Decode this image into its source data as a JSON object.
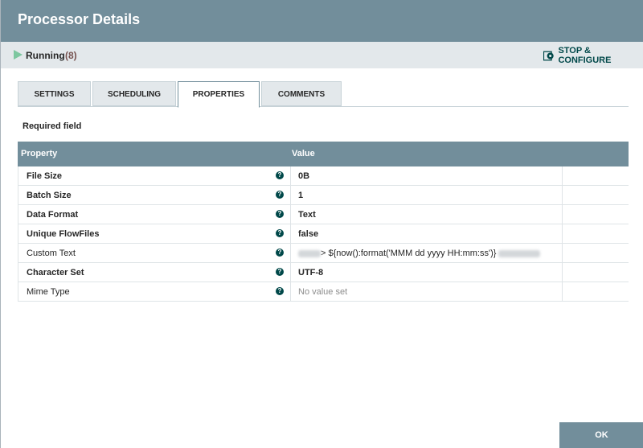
{
  "dialog": {
    "title": "Processor Details"
  },
  "status": {
    "label": "Running",
    "count": "(8)",
    "stop_configure": "STOP & CONFIGURE"
  },
  "tabs": [
    {
      "label": "SETTINGS"
    },
    {
      "label": "SCHEDULING"
    },
    {
      "label": "PROPERTIES",
      "active": true
    },
    {
      "label": "COMMENTS"
    }
  ],
  "required_note": "Required field",
  "table": {
    "headers": {
      "property": "Property",
      "value": "Value"
    },
    "rows": [
      {
        "name": "File Size",
        "required": true,
        "value": "0B"
      },
      {
        "name": "Batch Size",
        "required": true,
        "value": "1"
      },
      {
        "name": "Data Format",
        "required": true,
        "value": "Text"
      },
      {
        "name": "Unique FlowFiles",
        "required": true,
        "value": "false"
      },
      {
        "name": "Custom Text",
        "required": false,
        "value": "> ${now():format('MMM dd yyyy HH:mm:ss')} "
      },
      {
        "name": "Character Set",
        "required": true,
        "value": "UTF-8"
      },
      {
        "name": "Mime Type",
        "required": false,
        "value": "No value set"
      }
    ]
  },
  "footer": {
    "ok_label": "OK"
  },
  "colors": {
    "header": "#728e9b",
    "accent": "#004849",
    "running": "#7dc7a0"
  }
}
